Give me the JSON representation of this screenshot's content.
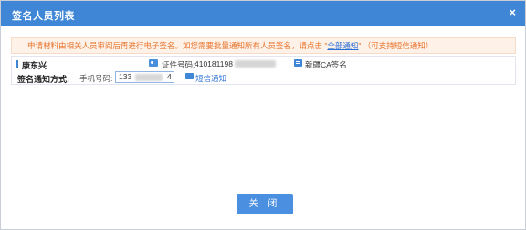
{
  "dialog": {
    "title": "签名人员列表",
    "close_icon": "×"
  },
  "notice": {
    "text_before": "申请材料由相关人员审阅后再进行电子签名。如您需要批量通知所有人员签名，请点击 \"",
    "link": "全部通知",
    "text_after": "\"  （可支持短信通知）"
  },
  "person": {
    "name": "康东兴",
    "id_label": "证件号码:",
    "id_value": "410181198",
    "ca_button": "新疆CA签名",
    "notify_label": "签名通知方式:",
    "phone_label": "手机号码:",
    "phone_value": "133",
    "phone_suffix": "4",
    "sms_button": "短信通知"
  },
  "footer": {
    "close_label": "关 闭"
  },
  "colors": {
    "titlebar": "#3f86d6",
    "notice_bg": "#fdf1e8",
    "notice_text": "#e8732a",
    "button": "#4a8fe0"
  },
  "icons": {
    "id_card": "id-card-icon",
    "ca": "ca-sign-icon",
    "sms": "sms-icon",
    "close": "close-icon"
  }
}
